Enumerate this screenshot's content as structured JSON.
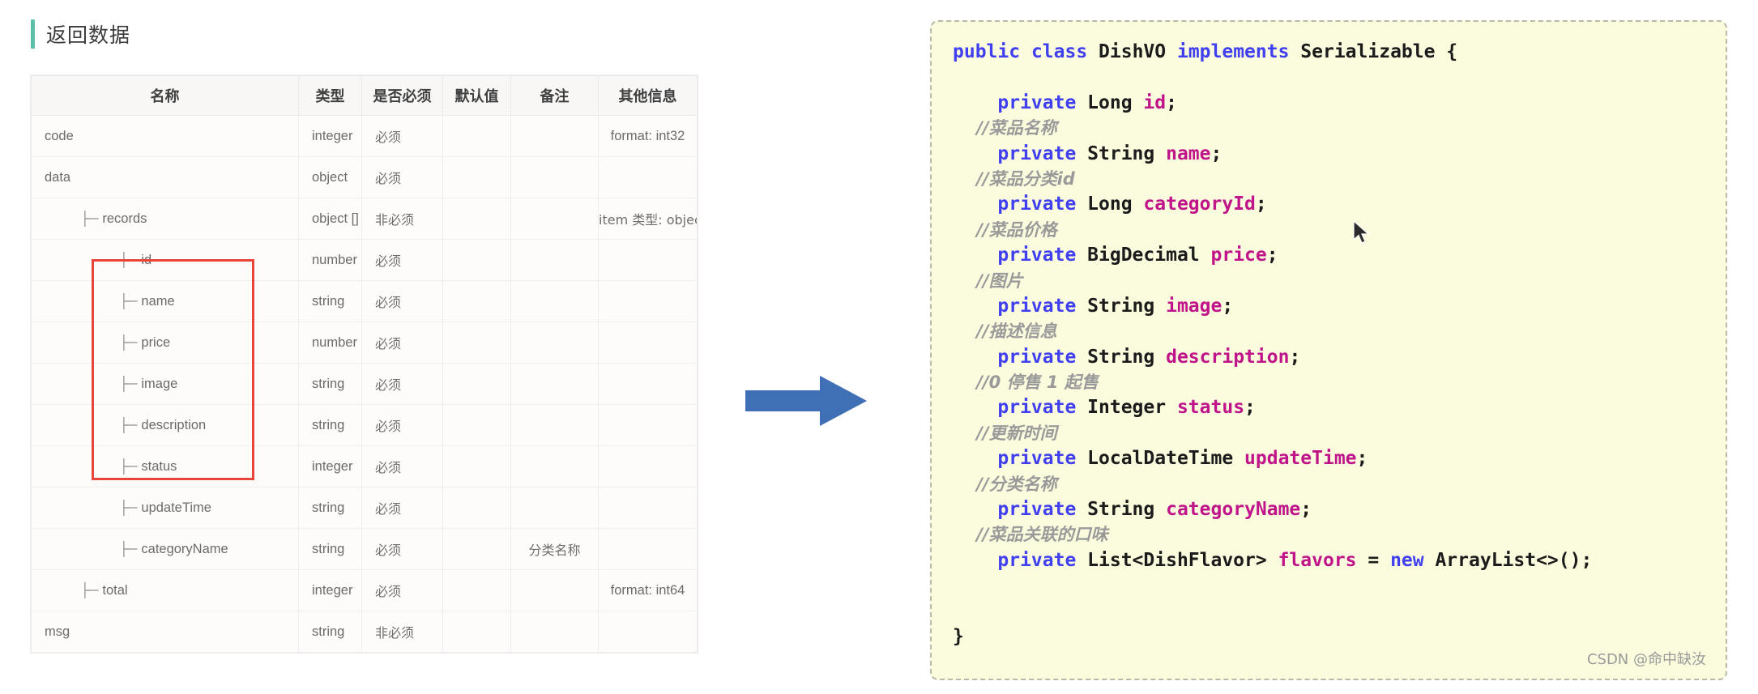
{
  "section": {
    "title": "返回数据",
    "accent_color": "#5bbfa8"
  },
  "table": {
    "headers": [
      "名称",
      "类型",
      "是否必须",
      "默认值",
      "备注",
      "其他信息"
    ],
    "rows": [
      {
        "indent": 0,
        "tree": "",
        "name": "code",
        "type": "integer",
        "required": "必须",
        "default": "",
        "memo": "",
        "other": "format: int32"
      },
      {
        "indent": 0,
        "tree": "",
        "name": "data",
        "type": "object",
        "required": "必须",
        "default": "",
        "memo": "",
        "other": ""
      },
      {
        "indent": 1,
        "tree": "├─",
        "name": "records",
        "type": "object []",
        "required": "非必须",
        "default": "",
        "memo": "",
        "other": "item 类型: object"
      },
      {
        "indent": 2,
        "tree": "├─",
        "name": "id",
        "type": "number",
        "required": "必须",
        "default": "",
        "memo": "",
        "other": ""
      },
      {
        "indent": 2,
        "tree": "├─",
        "name": "name",
        "type": "string",
        "required": "必须",
        "default": "",
        "memo": "",
        "other": ""
      },
      {
        "indent": 2,
        "tree": "├─",
        "name": "price",
        "type": "number",
        "required": "必须",
        "default": "",
        "memo": "",
        "other": ""
      },
      {
        "indent": 2,
        "tree": "├─",
        "name": "image",
        "type": "string",
        "required": "必须",
        "default": "",
        "memo": "",
        "other": ""
      },
      {
        "indent": 2,
        "tree": "├─",
        "name": "description",
        "type": "string",
        "required": "必须",
        "default": "",
        "memo": "",
        "other": ""
      },
      {
        "indent": 2,
        "tree": "├─",
        "name": "status",
        "type": "integer",
        "required": "必须",
        "default": "",
        "memo": "",
        "other": ""
      },
      {
        "indent": 2,
        "tree": "├─",
        "name": "updateTime",
        "type": "string",
        "required": "必须",
        "default": "",
        "memo": "",
        "other": ""
      },
      {
        "indent": 2,
        "tree": "├─",
        "name": "categoryName",
        "type": "string",
        "required": "必须",
        "default": "",
        "memo": "分类名称",
        "other": ""
      },
      {
        "indent": 1,
        "tree": "├─",
        "name": "total",
        "type": "integer",
        "required": "必须",
        "default": "",
        "memo": "",
        "other": "format: int64"
      },
      {
        "indent": 0,
        "tree": "",
        "name": "msg",
        "type": "string",
        "required": "非必须",
        "default": "",
        "memo": "",
        "other": ""
      }
    ],
    "highlight_color": "#e8443a"
  },
  "arrow": {
    "color": "#3f6fb5",
    "label": "maps-to-arrow"
  },
  "code": {
    "language": "java",
    "lines": [
      [
        {
          "t": "public ",
          "c": "kw"
        },
        {
          "t": "class ",
          "c": "kw"
        },
        {
          "t": "DishVO ",
          "c": "cls"
        },
        {
          "t": "implements ",
          "c": "kw"
        },
        {
          "t": "Serializable {",
          "c": "cls"
        }
      ],
      [],
      [
        {
          "t": "    ",
          "c": "pun"
        },
        {
          "t": "private ",
          "c": "kw"
        },
        {
          "t": "Long ",
          "c": "type"
        },
        {
          "t": "id",
          "c": "fld"
        },
        {
          "t": ";",
          "c": "pun"
        }
      ],
      [
        {
          "t": "    //菜品名称",
          "c": "cmt"
        }
      ],
      [
        {
          "t": "    ",
          "c": "pun"
        },
        {
          "t": "private ",
          "c": "kw"
        },
        {
          "t": "String ",
          "c": "type"
        },
        {
          "t": "name",
          "c": "fld"
        },
        {
          "t": ";",
          "c": "pun"
        }
      ],
      [
        {
          "t": "    //菜品分类id",
          "c": "cmt"
        }
      ],
      [
        {
          "t": "    ",
          "c": "pun"
        },
        {
          "t": "private ",
          "c": "kw"
        },
        {
          "t": "Long ",
          "c": "type"
        },
        {
          "t": "categoryId",
          "c": "fld"
        },
        {
          "t": ";",
          "c": "pun"
        }
      ],
      [
        {
          "t": "    //菜品价格",
          "c": "cmt"
        }
      ],
      [
        {
          "t": "    ",
          "c": "pun"
        },
        {
          "t": "private ",
          "c": "kw"
        },
        {
          "t": "BigDecimal ",
          "c": "type"
        },
        {
          "t": "price",
          "c": "fld"
        },
        {
          "t": ";",
          "c": "pun"
        }
      ],
      [
        {
          "t": "    //图片",
          "c": "cmt"
        }
      ],
      [
        {
          "t": "    ",
          "c": "pun"
        },
        {
          "t": "private ",
          "c": "kw"
        },
        {
          "t": "String ",
          "c": "type"
        },
        {
          "t": "image",
          "c": "fld"
        },
        {
          "t": ";",
          "c": "pun"
        }
      ],
      [
        {
          "t": "    //描述信息",
          "c": "cmt"
        }
      ],
      [
        {
          "t": "    ",
          "c": "pun"
        },
        {
          "t": "private ",
          "c": "kw"
        },
        {
          "t": "String ",
          "c": "type"
        },
        {
          "t": "description",
          "c": "fld"
        },
        {
          "t": ";",
          "c": "pun"
        }
      ],
      [
        {
          "t": "    //0 停售 1 起售",
          "c": "cmt"
        }
      ],
      [
        {
          "t": "    ",
          "c": "pun"
        },
        {
          "t": "private ",
          "c": "kw"
        },
        {
          "t": "Integer ",
          "c": "type"
        },
        {
          "t": "status",
          "c": "fld"
        },
        {
          "t": ";",
          "c": "pun"
        }
      ],
      [
        {
          "t": "    //更新时间",
          "c": "cmt"
        }
      ],
      [
        {
          "t": "    ",
          "c": "pun"
        },
        {
          "t": "private ",
          "c": "kw"
        },
        {
          "t": "LocalDateTime ",
          "c": "type"
        },
        {
          "t": "updateTime",
          "c": "fld"
        },
        {
          "t": ";",
          "c": "pun"
        }
      ],
      [
        {
          "t": "    //分类名称",
          "c": "cmt"
        }
      ],
      [
        {
          "t": "    ",
          "c": "pun"
        },
        {
          "t": "private ",
          "c": "kw"
        },
        {
          "t": "String ",
          "c": "type"
        },
        {
          "t": "categoryName",
          "c": "fld"
        },
        {
          "t": ";",
          "c": "pun"
        }
      ],
      [
        {
          "t": "    //菜品关联的口味",
          "c": "cmt"
        }
      ],
      [
        {
          "t": "    ",
          "c": "pun"
        },
        {
          "t": "private ",
          "c": "kw"
        },
        {
          "t": "List<DishFlavor> ",
          "c": "type"
        },
        {
          "t": "flavors",
          "c": "fld"
        },
        {
          "t": " = ",
          "c": "pun"
        },
        {
          "t": "new ",
          "c": "kw"
        },
        {
          "t": "ArrayList<>();",
          "c": "type"
        }
      ],
      [],
      [],
      [
        {
          "t": "}",
          "c": "pun"
        }
      ]
    ],
    "background": "#fbfbdd",
    "keyword_color": "#4040f0",
    "field_color": "#c0158a",
    "comment_color": "#9a9a9a"
  },
  "watermark": {
    "text": "CSDN @命中缺汝"
  }
}
